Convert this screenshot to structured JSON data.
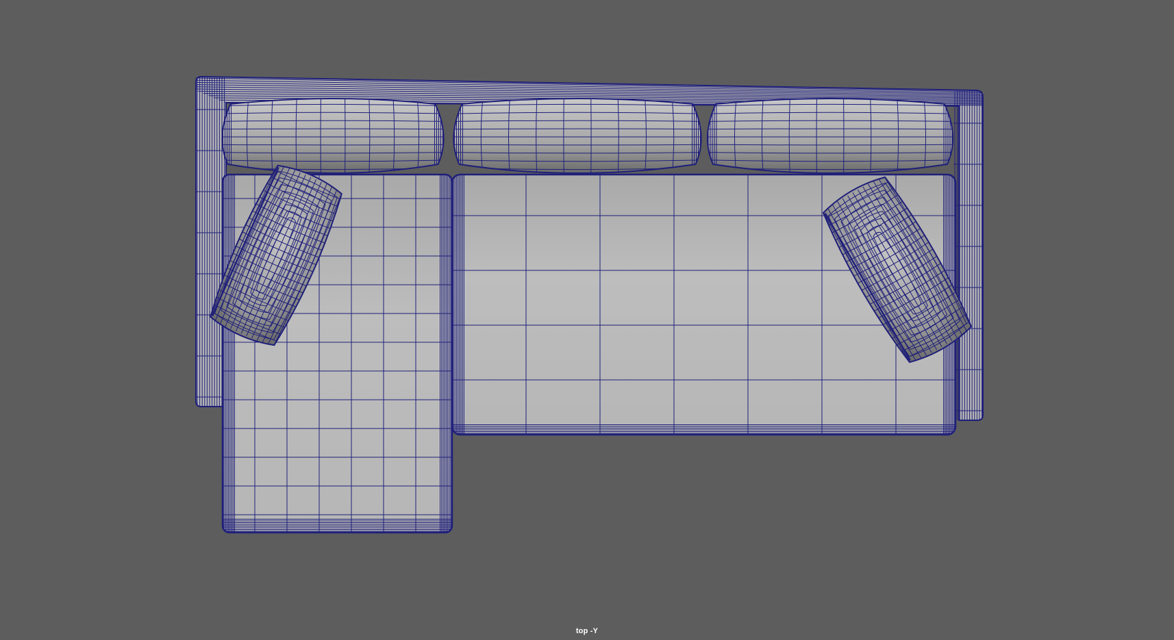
{
  "viewport": {
    "camera_label": "top -Y",
    "background_color": "#5d5d5d",
    "wire_color": "#1f1f7a",
    "surface_color": "#b2b2b2",
    "surface_dark": "#777777"
  },
  "model": {
    "icon": "sectional-sofa-wireframe"
  }
}
